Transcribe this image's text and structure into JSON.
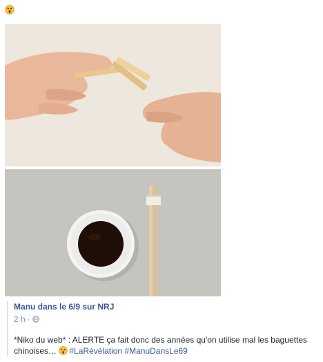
{
  "post": {
    "header_emoji": "astonished-face-icon",
    "photo_top": "hands-breaking-chopsticks-image",
    "photo_bottom": "soy-sauce-dish-and-chopsticks-image"
  },
  "share": {
    "page_name": "Manu dans le 6/9 sur NRJ",
    "time": "2 h",
    "separator": "·",
    "privacy_icon": "globe-icon",
    "text": "*Niko du web* : ALERTE ça fait donc des années qu'on utilise mal les baguettes chinoises… ",
    "inline_emoji": "astonished-face-icon",
    "hashtag_1": "#LaRévélation",
    "hashtag_2": "#ManuDansLe69"
  },
  "colors": {
    "link": "#365899",
    "meta": "#90949c",
    "text": "#1d2129",
    "emoji_face": "#f7c63a"
  }
}
